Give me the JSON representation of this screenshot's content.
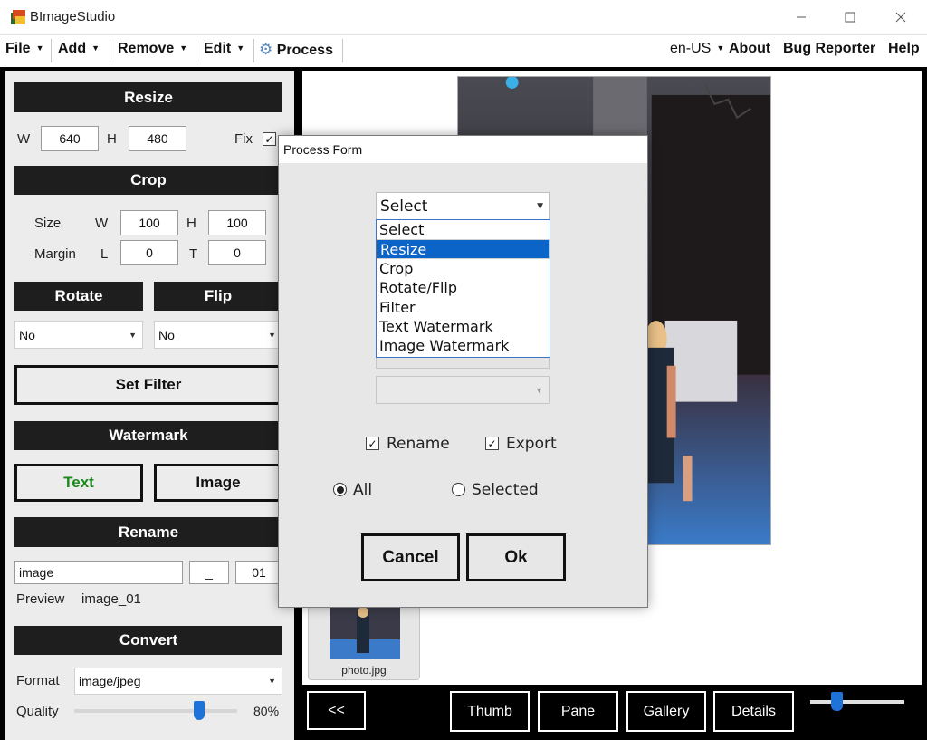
{
  "window": {
    "title": "BImageStudio"
  },
  "menu": {
    "file": "File",
    "add": "Add",
    "remove": "Remove",
    "edit": "Edit",
    "process": "Process",
    "language": "en-US",
    "about": "About",
    "bug_reporter": "Bug Reporter",
    "help": "Help"
  },
  "resize": {
    "header": "Resize",
    "w_label": "W",
    "w_value": "640",
    "h_label": "H",
    "h_value": "480",
    "fix_label": "Fix",
    "fix_checked": true
  },
  "crop": {
    "header": "Crop",
    "size_label": "Size",
    "w_label": "W",
    "w_value": "100",
    "h_label": "H",
    "h_value": "100",
    "margin_label": "Margin",
    "l_label": "L",
    "l_value": "0",
    "t_label": "T",
    "t_value": "0"
  },
  "rotate": {
    "header": "Rotate",
    "value": "No"
  },
  "flip": {
    "header": "Flip",
    "value": "No"
  },
  "filter": {
    "button": "Set Filter"
  },
  "watermark": {
    "header": "Watermark",
    "text_button": "Text",
    "image_button": "Image",
    "text_color": "#1a8a1a"
  },
  "rename": {
    "header": "Rename",
    "name_value": "image",
    "separator_value": "_",
    "start_value": "01",
    "preview_label": "Preview",
    "preview_value": "image_01"
  },
  "convert": {
    "header": "Convert",
    "format_label": "Format",
    "format_value": "image/jpeg",
    "quality_label": "Quality",
    "quality_value": "80%",
    "quality_fraction": 0.8
  },
  "thumbnail": {
    "filename": "photo.jpg"
  },
  "bottom": {
    "back": "<<",
    "thumb": "Thumb",
    "pane": "Pane",
    "gallery": "Gallery",
    "details": "Details"
  },
  "dialog": {
    "title": "Process Form",
    "select_value": "Select",
    "options": [
      "Select",
      "Resize",
      "Crop",
      "Rotate/Flip",
      "Filter",
      "Text Watermark",
      "Image Watermark"
    ],
    "selected_index": 1,
    "rename_label": "Rename",
    "rename_checked": true,
    "export_label": "Export",
    "export_checked": true,
    "all_label": "All",
    "selected_label": "Selected",
    "cancel": "Cancel",
    "ok": "Ok"
  },
  "colors": {
    "accent": "#0b64c8",
    "dark": "#1e1e1e"
  }
}
